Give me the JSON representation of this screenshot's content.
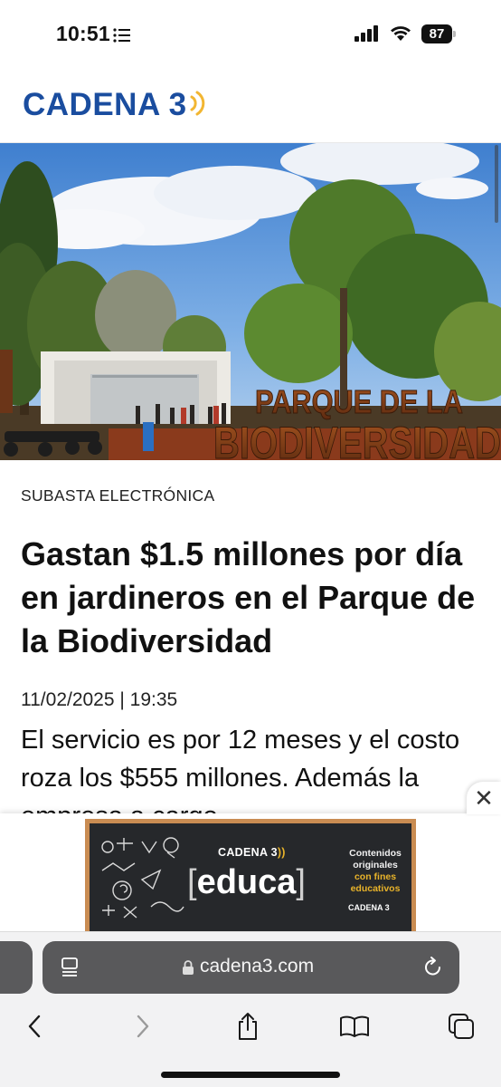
{
  "status_bar": {
    "time": "10:51",
    "battery": "87"
  },
  "site": {
    "logo_text": "CADENA 3",
    "brand_color": "#1a4d9f",
    "accent_color": "#f2b632"
  },
  "hero": {
    "sign_line1": "PARQUE DE LA",
    "sign_line2": "BIODIVERSIDAD"
  },
  "article": {
    "category": "SUBASTA ELECTRÓNICA",
    "headline": "Gastan $1.5 millones por día en jardineros en el Parque de la Biodiversidad",
    "date": "11/02/2025 | 19:35",
    "summary": "El servicio es por 12 meses y el costo roza los $555 millones. Además la empresa a cargo"
  },
  "ad": {
    "close_label": "✕",
    "brand": "CADENA 3",
    "main": "educa",
    "side_line1": "Contenidos",
    "side_line2": "originales",
    "side_line3": "con fines",
    "side_line4": "educativos",
    "small_brand": "CADENA 3"
  },
  "browser": {
    "url": "cadena3.com",
    "icons": [
      "reader-icon",
      "lock-icon",
      "reload-icon",
      "back-icon",
      "forward-icon",
      "share-icon",
      "bookmarks-icon",
      "tabs-icon"
    ]
  }
}
